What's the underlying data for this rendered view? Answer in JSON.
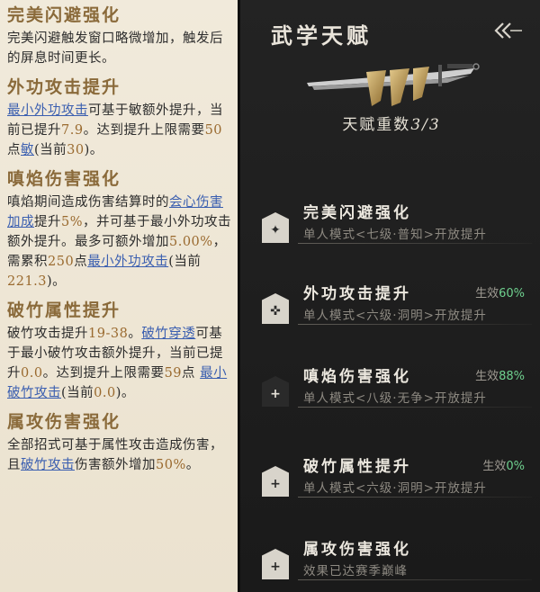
{
  "left": {
    "sections": [
      {
        "title": "完美闪避强化",
        "body": [
          {
            "t": "完美闪避触发窗口略微增加，触发后的屏息时间更长。"
          }
        ]
      },
      {
        "title": "外功攻击提升",
        "body": [
          {
            "t": "最小外功攻击",
            "c": "lnk"
          },
          {
            "t": "可基于敏额外提升，当前已提升"
          },
          {
            "t": "7.9",
            "c": "num"
          },
          {
            "t": "。达到提升上限需要"
          },
          {
            "t": "50",
            "c": "num"
          },
          {
            "t": "点"
          },
          {
            "t": "敏",
            "c": "lnk"
          },
          {
            "t": "(当前"
          },
          {
            "t": "30",
            "c": "num"
          },
          {
            "t": ")。"
          }
        ]
      },
      {
        "title": "嗔焰伤害强化",
        "body": [
          {
            "t": "嗔焰期间造成伤害结算时的"
          },
          {
            "t": "会心伤害加成",
            "c": "lnk"
          },
          {
            "t": "提升"
          },
          {
            "t": "5%",
            "c": "num"
          },
          {
            "t": "，并可基于最小外功攻击额外提升。最多可额外增加"
          },
          {
            "t": "5.00%",
            "c": "num"
          },
          {
            "t": "，需累积"
          },
          {
            "t": "250",
            "c": "num"
          },
          {
            "t": "点"
          },
          {
            "t": "最小外功攻击",
            "c": "lnk"
          },
          {
            "t": "(当前"
          },
          {
            "t": "221.3",
            "c": "num"
          },
          {
            "t": ")。"
          }
        ]
      },
      {
        "title": "破竹属性提升",
        "body": [
          {
            "t": "破竹攻击提升"
          },
          {
            "t": "19-38",
            "c": "num"
          },
          {
            "t": "。"
          },
          {
            "t": "破竹穿透",
            "c": "lnk"
          },
          {
            "t": "可基于最小破竹攻击额外提升，当前已提升"
          },
          {
            "t": "0.0",
            "c": "num"
          },
          {
            "t": "。达到提升上限需要"
          },
          {
            "t": "59",
            "c": "num"
          },
          {
            "t": "点 "
          },
          {
            "t": "最小破竹攻击",
            "c": "lnk"
          },
          {
            "t": "(当前"
          },
          {
            "t": "0.0",
            "c": "num"
          },
          {
            "t": ")。"
          }
        ]
      },
      {
        "title": "属攻伤害强化",
        "body": [
          {
            "t": "全部招式可基于属性攻击造成伤害，且"
          },
          {
            "t": "破竹攻击",
            "c": "lnk"
          },
          {
            "t": "伤害额外增加"
          },
          {
            "t": "50%",
            "c": "num"
          },
          {
            "t": "。"
          }
        ]
      }
    ]
  },
  "right": {
    "title": "武学天赋",
    "back_icon": "double-chevron-left-icon",
    "talent_count_label": "天赋重数",
    "talent_count_value": "3/3",
    "talents": [
      {
        "name": "完美闪避强化",
        "mode": "单人模式<七级·普知>开放提升",
        "effect_label": "",
        "effect_value": "",
        "icon": "dodge-icon",
        "glyph": "✦"
      },
      {
        "name": "外功攻击提升",
        "mode": "单人模式<六级·洞明>开放提升",
        "effect_label": "生效",
        "effect_value": "60%",
        "icon": "attack-icon",
        "glyph": "✜"
      },
      {
        "name": "嗔焰伤害强化",
        "mode": "单人模式<八级·无争>开放提升",
        "effect_label": "生效",
        "effect_value": "88%",
        "icon": "flame-icon",
        "glyph": "+"
      },
      {
        "name": "破竹属性提升",
        "mode": "单人模式<六级·洞明>开放提升",
        "effect_label": "生效",
        "effect_value": "0%",
        "icon": "bamboo-icon",
        "glyph": "+"
      },
      {
        "name": "属攻伤害强化",
        "mode": "效果已达赛季巅峰",
        "effect_label": "",
        "effect_value": "",
        "icon": "element-icon",
        "glyph": "+"
      }
    ]
  }
}
